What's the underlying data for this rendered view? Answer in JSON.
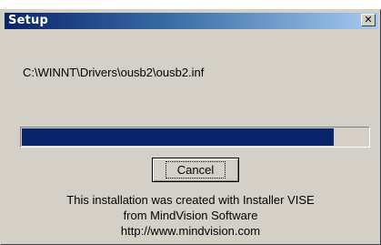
{
  "window": {
    "title": "Setup",
    "close_glyph": "✕"
  },
  "status": {
    "file_path": "C:\\WINNT\\Drivers\\ousb2\\ousb2.inf"
  },
  "progress": {
    "fraction": 0.9,
    "fill_color": "#0a246a"
  },
  "buttons": {
    "cancel_label": "Cancel"
  },
  "footer": {
    "line1": "This installation was created with Installer VISE",
    "line2": "from MindVision Software",
    "line3": "http://www.mindvision.com"
  },
  "colors": {
    "title_bar_start": "#0a246a",
    "title_bar_end": "#a6caf0",
    "dialog_face": "#d4d0c8"
  }
}
